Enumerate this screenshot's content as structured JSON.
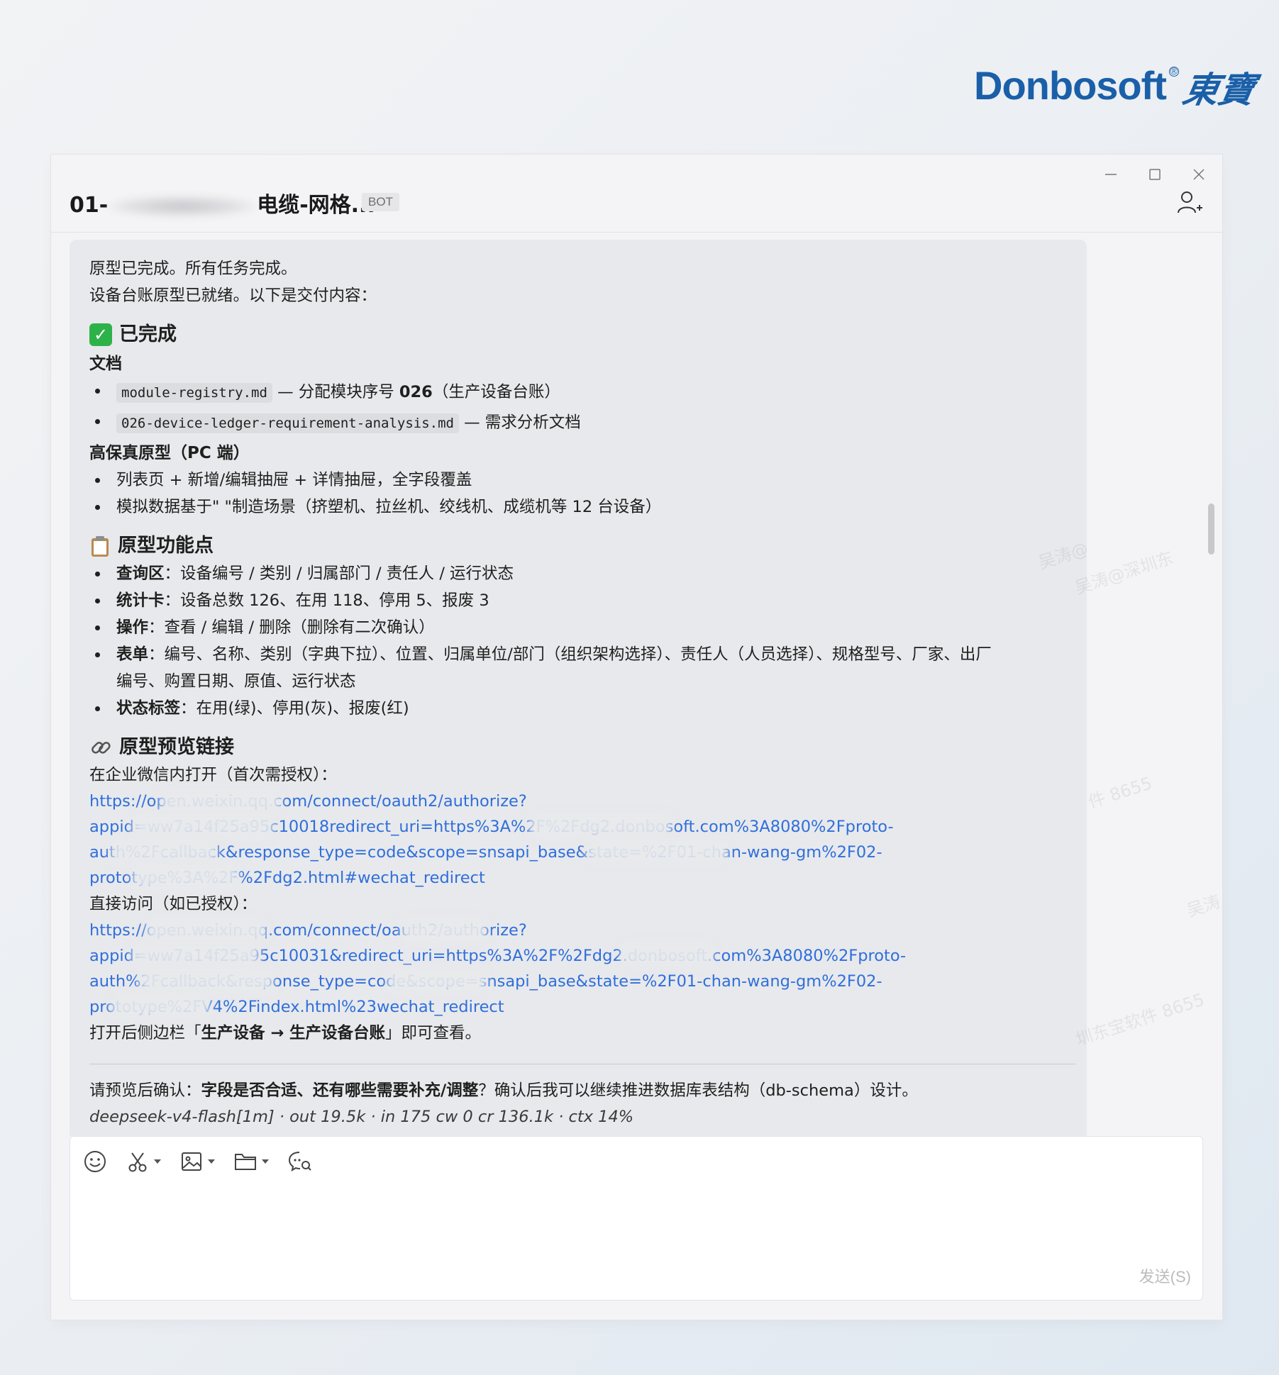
{
  "brand": {
    "name": "Donbosoft",
    "reg_mark": "®",
    "calligraphy": "東寶"
  },
  "window": {
    "title_start": "01-",
    "title_end": "电缆-网格...",
    "badge": "BOT"
  },
  "message": {
    "intro": [
      "原型已完成。所有任务完成。",
      "设备台账原型已就绪。以下是交付内容："
    ],
    "completed": {
      "heading": "已完成",
      "docs_heading": "文档",
      "docs": [
        {
          "code": "module-registry.md",
          "desc": "— 分配模块序号 ",
          "num": "026",
          "desc2": "（生产设备台账）"
        },
        {
          "code": "026-device-ledger-requirement-analysis.md",
          "desc": "— 需求分析文档"
        }
      ],
      "proto_heading": "高保真原型（PC 端）",
      "proto_items": [
        "列表页 + 新增/编辑抽屉 + 详情抽屉，全字段覆盖",
        "模拟数据基于\"            \"制造场景（挤塑机、拉丝机、绞线机、成缆机等 12 台设备）"
      ]
    },
    "features": {
      "heading": "原型功能点",
      "items": [
        {
          "label": "查询区",
          "text": "：设备编号 / 类别 / 归属部门 / 责任人 / 运行状态"
        },
        {
          "label": "统计卡",
          "text": "：设备总数 126、在用 118、停用 5、报废 3"
        },
        {
          "label": "操作",
          "text": "：查看 / 编辑 / 删除（删除有二次确认）"
        },
        {
          "label": "表单",
          "text": "：编号、名称、类别（字典下拉）、位置、归属单位/部门（组织架构选择）、责任人（人员选择）、规格型号、厂家、出厂",
          "text2": "编号、购置日期、原值、运行状态"
        },
        {
          "label": "状态标签",
          "text": "：在用(绿)、停用(灰)、报废(红)"
        }
      ]
    },
    "preview": {
      "heading": "原型预览链接",
      "open_in_wecom": "在企业微信内打开（首次需授权）：",
      "link1": [
        "https://open.weixin.qq.com/connect/oauth2/authorize?",
        "appid=ww7a14f25a95c10018redirect_uri=https%3A%2F%2Fdg2.donbosoft.com%3A8080%2Fproto-",
        "auth%2Fcallback&response_type=code&scope=snsapi_base&state=%2F01-chan-wang-gm%2F02-",
        "prototype%3A%2F%2Fdg2.html#wechat_redirect"
      ],
      "direct_access": "直接访问（如已授权）：",
      "link2": [
        "https://open.weixin.qq.com/connect/oauth2/authorize?",
        "appid=ww7a14f25a95c10031&redirect_uri=https%3A%2F%2Fdg2.donbosoft.com%3A8080%2Fproto-",
        "auth%2Fcallback&response_type=code&scope=snsapi_base&state=%2F01-chan-wang-gm%2F02-",
        "prototype%2FV4%2Findex.html%23wechat_redirect"
      ],
      "nav_pre": "打开后侧边栏「",
      "nav_bold": "生产设备 → 生产设备台账",
      "nav_post": "」即可查看。"
    },
    "confirm_pre": "请预览后确认：",
    "confirm_bold": "字段是否合适、还有哪些需要补充/调整",
    "confirm_post": "？确认后我可以继续推进数据库表结构（db-schema）设计。",
    "meta": "deepseek-v4-flash[1m] · out 19.5k · in 175 cw 0 cr 136.1k · ctx 14%"
  },
  "composer": {
    "send_label": "发送(S)",
    "placeholder": ""
  },
  "watermark": {
    "texts": [
      "吴涛@深圳东宝软件 8",
      "吴涛@深圳东",
      "件 8655",
      "圳东宝软件 8655",
      "吴涛"
    ]
  },
  "icons": {
    "minimize": "minimize-icon",
    "maximize": "maximize-icon",
    "close": "close-icon",
    "add_member": "add-member-icon",
    "emoji": "emoji-icon",
    "screenshot": "scissors-icon",
    "image": "image-icon",
    "folder": "folder-icon",
    "chat_search": "chat-history-icon"
  }
}
